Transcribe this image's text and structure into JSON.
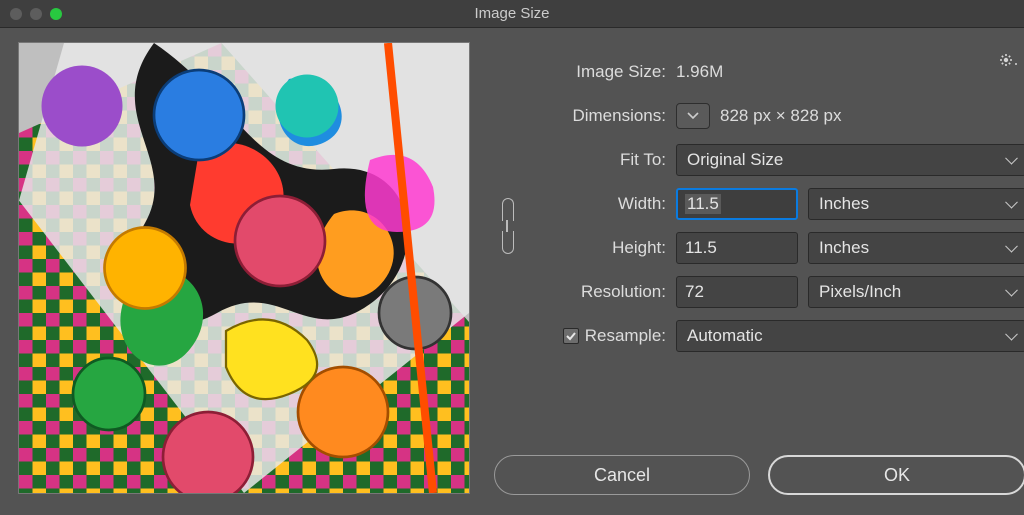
{
  "window": {
    "title": "Image Size"
  },
  "labels": {
    "image_size": "Image Size:",
    "dimensions": "Dimensions:",
    "fit_to": "Fit To:",
    "width": "Width:",
    "height": "Height:",
    "resolution": "Resolution:",
    "resample": "Resample:"
  },
  "values": {
    "image_size": "1.96M",
    "dimensions": "828 px  ×  828 px",
    "fit_to": "Original Size",
    "width": "11.5",
    "width_unit": "Inches",
    "height": "11.5",
    "height_unit": "Inches",
    "resolution": "72",
    "resolution_unit": "Pixels/Inch",
    "resample_checked": true,
    "resample_mode": "Automatic"
  },
  "buttons": {
    "cancel": "Cancel",
    "ok": "OK"
  }
}
